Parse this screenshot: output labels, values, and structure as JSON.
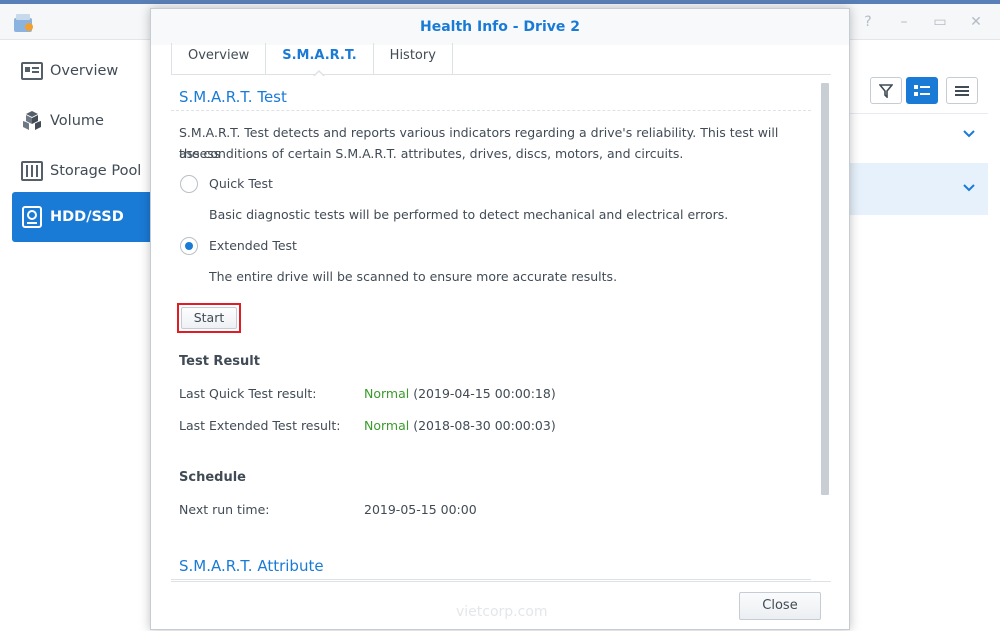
{
  "sidebar": {
    "items": [
      {
        "label": "Overview"
      },
      {
        "label": "Volume"
      },
      {
        "label": "Storage Pool"
      },
      {
        "label": "HDD/SSD"
      }
    ]
  },
  "dialog": {
    "title": "Health Info - Drive 2",
    "tabs": [
      {
        "label": "Overview"
      },
      {
        "label": "S.M.A.R.T."
      },
      {
        "label": "History"
      }
    ],
    "smart_test": {
      "title": "S.M.A.R.T. Test",
      "description_line1": "S.M.A.R.T. Test detects and reports various indicators regarding a drive's reliability. This test will assess",
      "description_line2": "the conditions of certain S.M.A.R.T. attributes, drives, discs, motors, and circuits.",
      "quick_label": "Quick Test",
      "quick_desc": "Basic diagnostic tests will be performed to detect mechanical and electrical errors.",
      "extended_label": "Extended Test",
      "extended_desc": "The entire drive will be scanned to ensure more accurate results.",
      "start_label": "Start"
    },
    "test_result": {
      "heading": "Test Result",
      "quick_label": "Last Quick Test result:",
      "quick_status": "Normal",
      "quick_time": " (2019-04-15 00:00:18)",
      "extended_label": "Last Extended Test result:",
      "extended_status": "Normal",
      "extended_time": " (2018-08-30 00:00:03)"
    },
    "schedule": {
      "heading": "Schedule",
      "next_label": "Next run time:",
      "next_value": "2019-05-15 00:00"
    },
    "smart_attribute_title": "S.M.A.R.T. Attribute",
    "close_label": "Close"
  },
  "watermark": "vietcorp.com",
  "colors": {
    "accent": "#1a7bd6",
    "ok": "#3a9b2c",
    "highlight": "#e01d24"
  }
}
